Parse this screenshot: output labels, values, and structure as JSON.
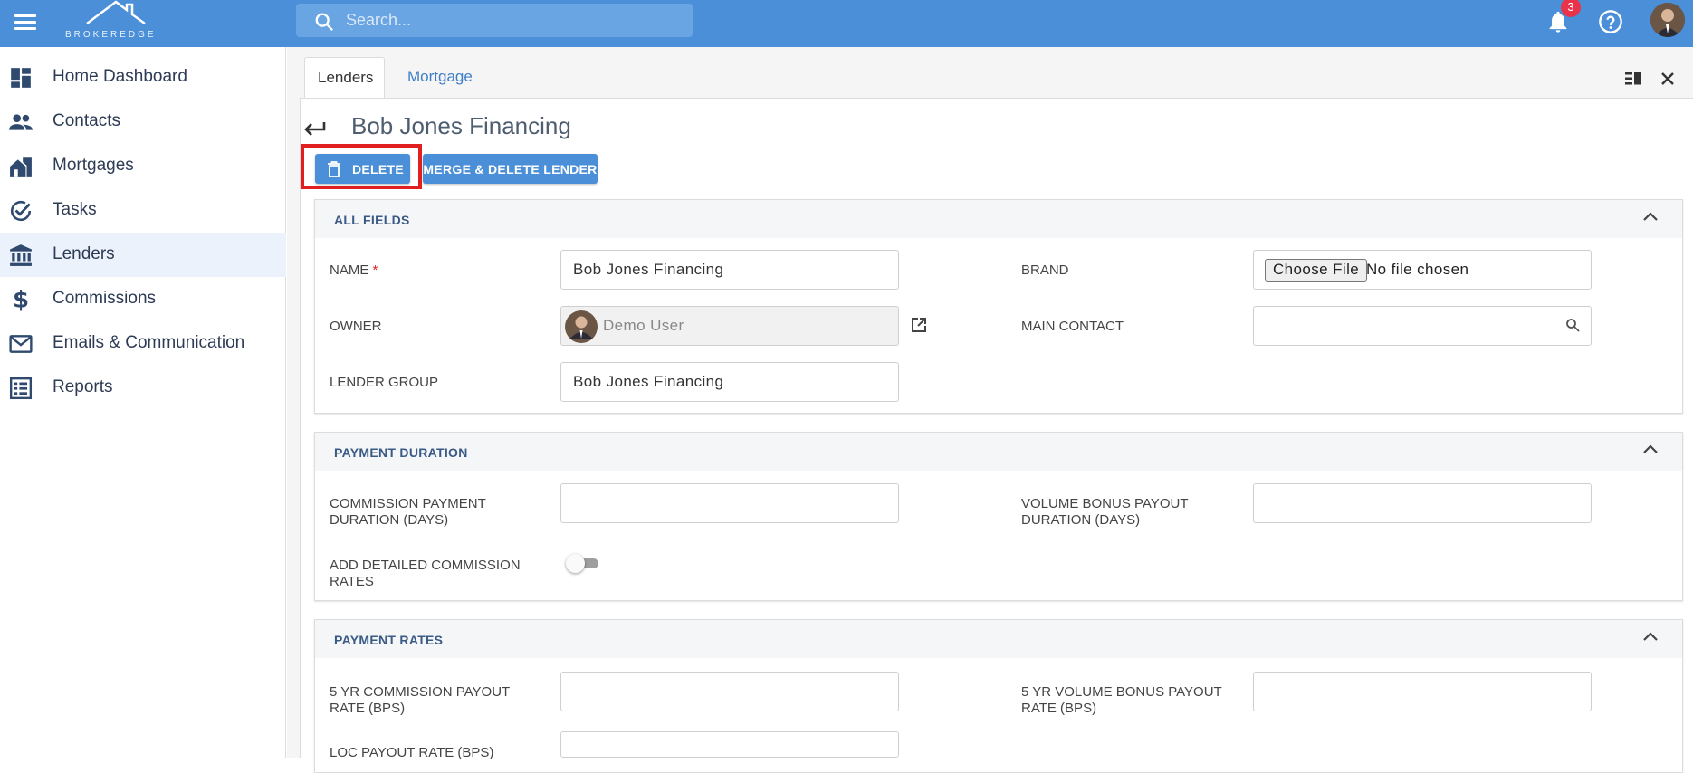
{
  "header": {
    "brand": "BROKEREDGE",
    "search_placeholder": "Search...",
    "notification_count": "3"
  },
  "sidebar": {
    "items": [
      {
        "label": "Home Dashboard",
        "icon": "dashboard-icon"
      },
      {
        "label": "Contacts",
        "icon": "contacts-icon"
      },
      {
        "label": "Mortgages",
        "icon": "mortgages-icon"
      },
      {
        "label": "Tasks",
        "icon": "tasks-icon"
      },
      {
        "label": "Lenders",
        "icon": "bank-icon",
        "active": true
      },
      {
        "label": "Commissions",
        "icon": "dollar-icon"
      },
      {
        "label": "Emails & Communication",
        "icon": "mail-icon"
      },
      {
        "label": "Reports",
        "icon": "reports-icon"
      }
    ]
  },
  "tabs": [
    {
      "label": "Lenders",
      "active": true
    },
    {
      "label": "Mortgage",
      "active": false
    }
  ],
  "page": {
    "title": "Bob Jones Financing",
    "delete_label": "DELETE",
    "merge_label": "MERGE & DELETE LENDER"
  },
  "sections": {
    "all_fields": {
      "title": "ALL FIELDS",
      "name_label": "NAME",
      "name_required": "*",
      "name_value": "Bob Jones Financing",
      "brand_label": "BRAND",
      "brand_button": "Choose File",
      "brand_status": "No file chosen",
      "owner_label": "OWNER",
      "owner_value": "Demo User",
      "main_contact_label": "MAIN CONTACT",
      "main_contact_value": "",
      "lender_group_label": "LENDER GROUP",
      "lender_group_value": "Bob Jones Financing"
    },
    "payment_duration": {
      "title": "PAYMENT DURATION",
      "commission_label": "COMMISSION PAYMENT DURATION (DAYS)",
      "commission_value": "",
      "volume_label": "VOLUME BONUS PAYOUT DURATION (DAYS)",
      "volume_value": "",
      "detailed_label": "ADD DETAILED COMMISSION RATES",
      "detailed_enabled": false
    },
    "payment_rates": {
      "title": "PAYMENT RATES",
      "five_yr_commission_label": "5 YR COMMISSION PAYOUT RATE (BPS)",
      "five_yr_commission_value": "",
      "five_yr_volume_label": "5 YR VOLUME BONUS PAYOUT RATE (BPS)",
      "five_yr_volume_value": "",
      "loc_label": "LOC PAYOUT RATE (BPS)",
      "loc_value": ""
    }
  },
  "colors": {
    "primary": "#4a8fd8",
    "highlight": "#e02020",
    "badge": "#e8334a",
    "section_title": "#3a5a86"
  }
}
